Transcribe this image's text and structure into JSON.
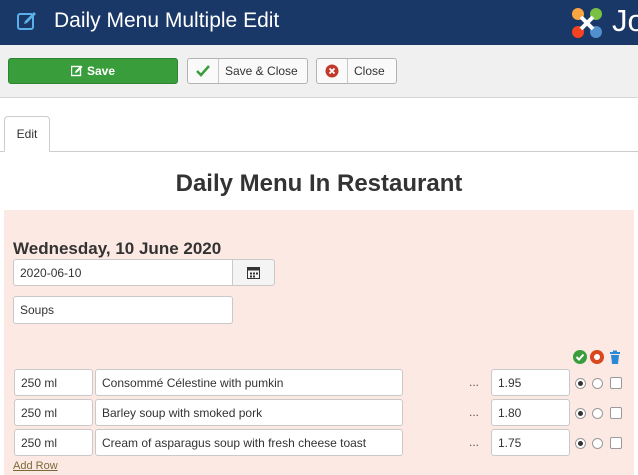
{
  "header": {
    "title": "Daily Menu Multiple Edit",
    "logo_text": "Jo"
  },
  "toolbar": {
    "save_label": "Save",
    "save_close_label": "Save & Close",
    "close_label": "Close"
  },
  "tabs": [
    {
      "label": "Edit"
    }
  ],
  "page": {
    "heading": "Daily Menu In Restaurant"
  },
  "menu": {
    "day_title": "Wednesday, 10 June 2020",
    "date_value": "2020-06-10",
    "category_value": "Soups",
    "rows": [
      {
        "amount": "250 ml",
        "name": "Consommé Célestine with pumkin",
        "dots": "...",
        "price": "1.95"
      },
      {
        "amount": "250 ml",
        "name": "Barley soup with smoked pork",
        "dots": "...",
        "price": "1.80"
      },
      {
        "amount": "250 ml",
        "name": "Cream of asparagus soup with fresh cheese toast",
        "dots": "...",
        "price": "1.75"
      }
    ],
    "add_row_label": "Add Row"
  },
  "icons": {
    "header_icons": [
      "check-circle-icon",
      "no-circle-icon",
      "trash-icon"
    ]
  },
  "colors": {
    "header_bg": "#1a3867",
    "save_green": "#3a9d3c",
    "panel_bg": "#fde9e3"
  }
}
